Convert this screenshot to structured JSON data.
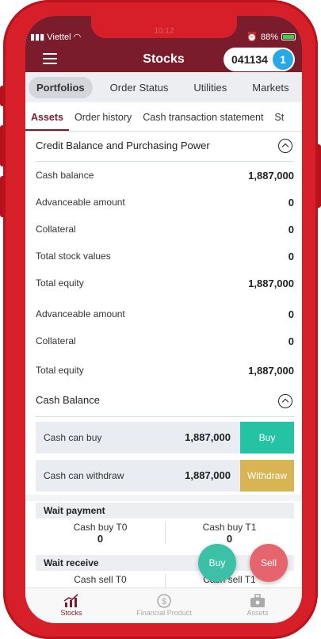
{
  "status_bar": {
    "carrier": "Viettel",
    "time": "10:12",
    "battery": "88%"
  },
  "header": {
    "title": "Stocks",
    "account_number": "041134",
    "account_badge": "1"
  },
  "top_tabs": [
    "Portfolios",
    "Order Status",
    "Utilities",
    "Markets"
  ],
  "sub_tabs": [
    "Assets",
    "Order history",
    "Cash transaction statement",
    "St"
  ],
  "credit_section": {
    "title": "Credit Balance and Purchasing Power",
    "rows": [
      {
        "label": "Cash balance",
        "value": "1,887,000"
      },
      {
        "label": "Advanceable amount",
        "value": "0"
      },
      {
        "label": "Collateral",
        "value": "0"
      },
      {
        "label": "Total stock values",
        "value": "0"
      },
      {
        "label": "Total equity",
        "value": "1,887,000"
      },
      {
        "label": "Advanceable amount",
        "value": "0"
      },
      {
        "label": "Collateral",
        "value": "0"
      },
      {
        "label": "Total equity",
        "value": "1,887,000"
      }
    ]
  },
  "cash_section": {
    "title": "Cash Balance",
    "rows": [
      {
        "label": "Cash can buy",
        "value": "1,887,000",
        "button": "Buy",
        "color": "#25c3a6"
      },
      {
        "label": "Cash can withdraw",
        "value": "1,887,000",
        "button": "Withdraw",
        "color": "#d9b453"
      }
    ]
  },
  "wait_payment": {
    "title": "Wait payment",
    "t0_label": "Cash buy T0",
    "t0_value": "0",
    "t1_label": "Cash buy T1",
    "t1_value": "0"
  },
  "wait_receive": {
    "title": "Wait receive",
    "t0_label": "Cash sell T0",
    "t1_label": "Cash sell T1"
  },
  "fab": {
    "buy": "Buy",
    "sell": "Sell",
    "buy_color": "#3cc1a7",
    "sell_color": "#e5646e"
  },
  "bottom_nav": [
    "Stocks",
    "Financial Product",
    "Assets"
  ],
  "colors": {
    "brand": "#7b1c2c",
    "frame": "#d61f28"
  }
}
